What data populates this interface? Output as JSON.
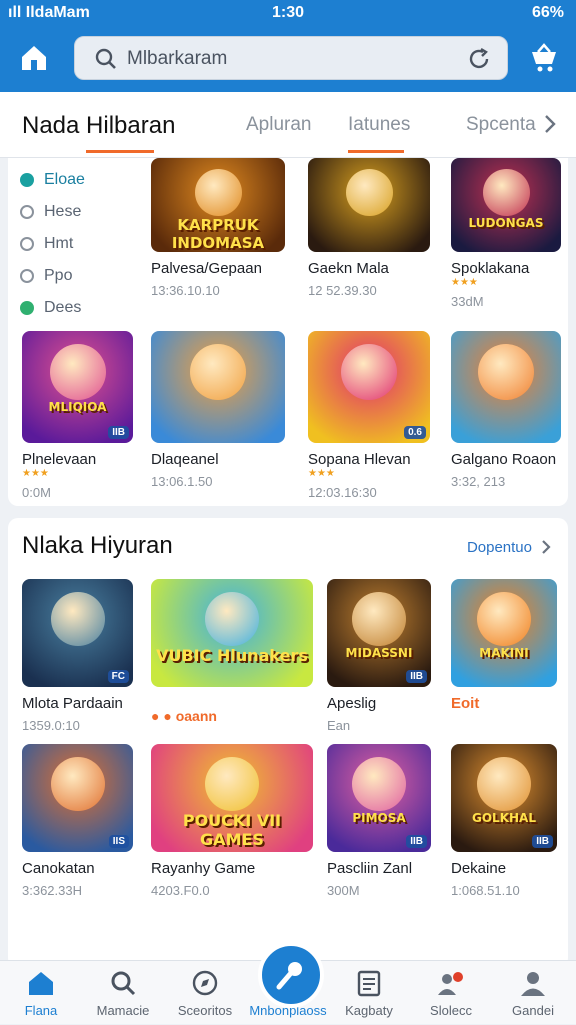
{
  "status": {
    "carrier": "ıll IldaMam",
    "time": "1:30",
    "battery": "66%"
  },
  "search": {
    "placeholder": "Mlbarkaram"
  },
  "tabs": {
    "brand": "Nada Hilbaran",
    "items": [
      "Apluran",
      "Iatunes",
      "Spcenta"
    ]
  },
  "sidebar": {
    "items": [
      "Eloae",
      "Hese",
      "Hmt",
      "Ppo",
      "Dees"
    ]
  },
  "row1": [
    {
      "name": "Palvesa/Gepaan",
      "sub": "13:36.10.10",
      "title": "KARPRUK INDOMASA",
      "bg": [
        "#5a2a0a",
        "#e08a20"
      ]
    },
    {
      "name": "Gaekn Mala",
      "sub": "12 52.39.30",
      "title": "",
      "bg": [
        "#2a1a10",
        "#d8a020"
      ]
    },
    {
      "name": "Spoklakana",
      "sub": "33dM",
      "title": "LUDONGAS",
      "bg": [
        "#1a1a40",
        "#c03050"
      ],
      "stars": "★★★"
    }
  ],
  "row2": [
    {
      "name": "Plnelevaan",
      "sub": "0:0M",
      "title": "MLIQIOA",
      "bg": [
        "#5a1a9a",
        "#e05090"
      ],
      "stars": "★★★",
      "badge": "IIB"
    },
    {
      "name": "Dlaqeanel",
      "sub": "13:06.1.50",
      "title": "",
      "bg": [
        "#3a8ad8",
        "#f0a040"
      ]
    },
    {
      "name": "Sopana Hlevan",
      "sub": "12:03.16:30",
      "title": "",
      "bg": [
        "#f0c020",
        "#e03070"
      ],
      "stars": "★★★",
      "badge": "0.6"
    },
    {
      "name": "Galgano Roaon",
      "sub": "3:32, 213",
      "title": "",
      "bg": [
        "#3aa0d8",
        "#f08030"
      ]
    }
  ],
  "section2": {
    "title": "Nlaka Hiyuran",
    "more": "Dopentuo"
  },
  "row3": [
    {
      "name": "Mlota Pardaain",
      "sub": "1359.0:10",
      "title": "",
      "bg": [
        "#1a3050",
        "#4a80a0"
      ],
      "badge": "FC"
    },
    {
      "name": "",
      "sub": "",
      "title": "VUBIC Hlunakers",
      "bg": [
        "#c8e840",
        "#40b0e0"
      ]
    },
    {
      "name": "Apeslig",
      "sub": "Ean",
      "title": "MIDASSNI",
      "bg": [
        "#2a1a10",
        "#c08030"
      ],
      "badge": "IIB"
    },
    {
      "name": "Eoit",
      "sub": "",
      "title": "MAKINI",
      "bg": [
        "#30a0e0",
        "#f08020"
      ]
    }
  ],
  "row3_mid_line": "oaann",
  "row4": [
    {
      "name": "Canokatan",
      "sub": "3:362.33H",
      "title": "",
      "bg": [
        "#2a5aa0",
        "#e07030"
      ],
      "badge": "IIS"
    },
    {
      "name": "Rayanhy Game",
      "sub": "4203.F0.0",
      "title": "POUCKI VII GAMES",
      "bg": [
        "#e04080",
        "#f0c030"
      ]
    },
    {
      "name": "Pascliin Zanl",
      "sub": "300M",
      "title": "PIMOSA",
      "bg": [
        "#4a2a9a",
        "#e060a0"
      ],
      "badge": "IIB"
    },
    {
      "name": "Dekaine",
      "sub": "1:068.51.10",
      "title": "GOLKHAL",
      "bg": [
        "#2a1a10",
        "#e09030"
      ],
      "badge": "IIB"
    }
  ],
  "nav": [
    "Flana",
    "Mamacie",
    "Sceoritos",
    "Mnbonplaoss",
    "Kagbaty",
    "Slolecc",
    "Gandei"
  ],
  "colors": {
    "primary": "#1d7fd1",
    "accent": "#f06a2a"
  }
}
